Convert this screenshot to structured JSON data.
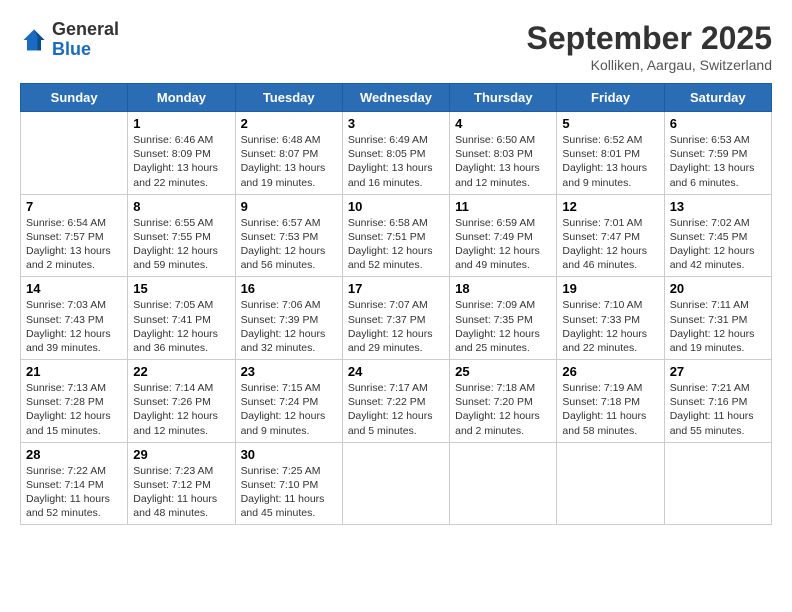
{
  "header": {
    "logo_general": "General",
    "logo_blue": "Blue",
    "title": "September 2025",
    "subtitle": "Kolliken, Aargau, Switzerland"
  },
  "days": [
    "Sunday",
    "Monday",
    "Tuesday",
    "Wednesday",
    "Thursday",
    "Friday",
    "Saturday"
  ],
  "weeks": [
    [
      {
        "date": "",
        "lines": []
      },
      {
        "date": "1",
        "lines": [
          "Sunrise: 6:46 AM",
          "Sunset: 8:09 PM",
          "Daylight: 13 hours",
          "and 22 minutes."
        ]
      },
      {
        "date": "2",
        "lines": [
          "Sunrise: 6:48 AM",
          "Sunset: 8:07 PM",
          "Daylight: 13 hours",
          "and 19 minutes."
        ]
      },
      {
        "date": "3",
        "lines": [
          "Sunrise: 6:49 AM",
          "Sunset: 8:05 PM",
          "Daylight: 13 hours",
          "and 16 minutes."
        ]
      },
      {
        "date": "4",
        "lines": [
          "Sunrise: 6:50 AM",
          "Sunset: 8:03 PM",
          "Daylight: 13 hours",
          "and 12 minutes."
        ]
      },
      {
        "date": "5",
        "lines": [
          "Sunrise: 6:52 AM",
          "Sunset: 8:01 PM",
          "Daylight: 13 hours",
          "and 9 minutes."
        ]
      },
      {
        "date": "6",
        "lines": [
          "Sunrise: 6:53 AM",
          "Sunset: 7:59 PM",
          "Daylight: 13 hours",
          "and 6 minutes."
        ]
      }
    ],
    [
      {
        "date": "7",
        "lines": [
          "Sunrise: 6:54 AM",
          "Sunset: 7:57 PM",
          "Daylight: 13 hours",
          "and 2 minutes."
        ]
      },
      {
        "date": "8",
        "lines": [
          "Sunrise: 6:55 AM",
          "Sunset: 7:55 PM",
          "Daylight: 12 hours",
          "and 59 minutes."
        ]
      },
      {
        "date": "9",
        "lines": [
          "Sunrise: 6:57 AM",
          "Sunset: 7:53 PM",
          "Daylight: 12 hours",
          "and 56 minutes."
        ]
      },
      {
        "date": "10",
        "lines": [
          "Sunrise: 6:58 AM",
          "Sunset: 7:51 PM",
          "Daylight: 12 hours",
          "and 52 minutes."
        ]
      },
      {
        "date": "11",
        "lines": [
          "Sunrise: 6:59 AM",
          "Sunset: 7:49 PM",
          "Daylight: 12 hours",
          "and 49 minutes."
        ]
      },
      {
        "date": "12",
        "lines": [
          "Sunrise: 7:01 AM",
          "Sunset: 7:47 PM",
          "Daylight: 12 hours",
          "and 46 minutes."
        ]
      },
      {
        "date": "13",
        "lines": [
          "Sunrise: 7:02 AM",
          "Sunset: 7:45 PM",
          "Daylight: 12 hours",
          "and 42 minutes."
        ]
      }
    ],
    [
      {
        "date": "14",
        "lines": [
          "Sunrise: 7:03 AM",
          "Sunset: 7:43 PM",
          "Daylight: 12 hours",
          "and 39 minutes."
        ]
      },
      {
        "date": "15",
        "lines": [
          "Sunrise: 7:05 AM",
          "Sunset: 7:41 PM",
          "Daylight: 12 hours",
          "and 36 minutes."
        ]
      },
      {
        "date": "16",
        "lines": [
          "Sunrise: 7:06 AM",
          "Sunset: 7:39 PM",
          "Daylight: 12 hours",
          "and 32 minutes."
        ]
      },
      {
        "date": "17",
        "lines": [
          "Sunrise: 7:07 AM",
          "Sunset: 7:37 PM",
          "Daylight: 12 hours",
          "and 29 minutes."
        ]
      },
      {
        "date": "18",
        "lines": [
          "Sunrise: 7:09 AM",
          "Sunset: 7:35 PM",
          "Daylight: 12 hours",
          "and 25 minutes."
        ]
      },
      {
        "date": "19",
        "lines": [
          "Sunrise: 7:10 AM",
          "Sunset: 7:33 PM",
          "Daylight: 12 hours",
          "and 22 minutes."
        ]
      },
      {
        "date": "20",
        "lines": [
          "Sunrise: 7:11 AM",
          "Sunset: 7:31 PM",
          "Daylight: 12 hours",
          "and 19 minutes."
        ]
      }
    ],
    [
      {
        "date": "21",
        "lines": [
          "Sunrise: 7:13 AM",
          "Sunset: 7:28 PM",
          "Daylight: 12 hours",
          "and 15 minutes."
        ]
      },
      {
        "date": "22",
        "lines": [
          "Sunrise: 7:14 AM",
          "Sunset: 7:26 PM",
          "Daylight: 12 hours",
          "and 12 minutes."
        ]
      },
      {
        "date": "23",
        "lines": [
          "Sunrise: 7:15 AM",
          "Sunset: 7:24 PM",
          "Daylight: 12 hours",
          "and 9 minutes."
        ]
      },
      {
        "date": "24",
        "lines": [
          "Sunrise: 7:17 AM",
          "Sunset: 7:22 PM",
          "Daylight: 12 hours",
          "and 5 minutes."
        ]
      },
      {
        "date": "25",
        "lines": [
          "Sunrise: 7:18 AM",
          "Sunset: 7:20 PM",
          "Daylight: 12 hours",
          "and 2 minutes."
        ]
      },
      {
        "date": "26",
        "lines": [
          "Sunrise: 7:19 AM",
          "Sunset: 7:18 PM",
          "Daylight: 11 hours",
          "and 58 minutes."
        ]
      },
      {
        "date": "27",
        "lines": [
          "Sunrise: 7:21 AM",
          "Sunset: 7:16 PM",
          "Daylight: 11 hours",
          "and 55 minutes."
        ]
      }
    ],
    [
      {
        "date": "28",
        "lines": [
          "Sunrise: 7:22 AM",
          "Sunset: 7:14 PM",
          "Daylight: 11 hours",
          "and 52 minutes."
        ]
      },
      {
        "date": "29",
        "lines": [
          "Sunrise: 7:23 AM",
          "Sunset: 7:12 PM",
          "Daylight: 11 hours",
          "and 48 minutes."
        ]
      },
      {
        "date": "30",
        "lines": [
          "Sunrise: 7:25 AM",
          "Sunset: 7:10 PM",
          "Daylight: 11 hours",
          "and 45 minutes."
        ]
      },
      {
        "date": "",
        "lines": []
      },
      {
        "date": "",
        "lines": []
      },
      {
        "date": "",
        "lines": []
      },
      {
        "date": "",
        "lines": []
      }
    ]
  ]
}
